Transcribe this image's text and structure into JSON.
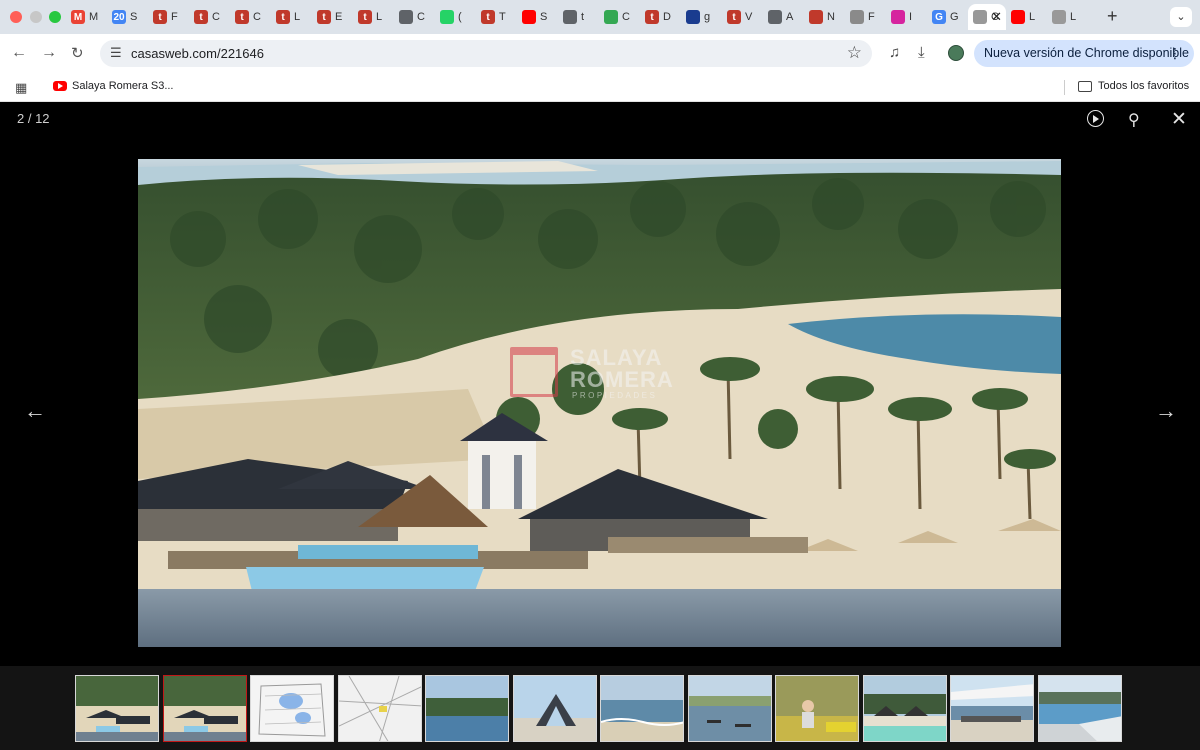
{
  "browser": {
    "tabs": [
      {
        "icon": "gmail-icon",
        "letter": "M",
        "color": "#ea4335",
        "title": "M"
      },
      {
        "icon": "calendar-icon",
        "letter": "20",
        "color": "#4285f4",
        "title": "S"
      },
      {
        "icon": "tokko-icon",
        "letter": "t",
        "color": "#c0392b",
        "title": "F"
      },
      {
        "icon": "tokko-icon",
        "letter": "t",
        "color": "#c0392b",
        "title": "C"
      },
      {
        "icon": "tokko-icon",
        "letter": "t",
        "color": "#c0392b",
        "title": "C"
      },
      {
        "icon": "tokko-icon",
        "letter": "t",
        "color": "#c0392b",
        "title": "L"
      },
      {
        "icon": "tokko-icon",
        "letter": "t",
        "color": "#c0392b",
        "title": "E"
      },
      {
        "icon": "tokko-icon",
        "letter": "t",
        "color": "#c0392b",
        "title": "L"
      },
      {
        "icon": "globe-icon",
        "letter": "",
        "color": "#5f6368",
        "title": "C"
      },
      {
        "icon": "whatsapp-icon",
        "letter": "",
        "color": "#25d366",
        "title": "("
      },
      {
        "icon": "tokko-icon",
        "letter": "t",
        "color": "#c0392b",
        "title": "T"
      },
      {
        "icon": "youtube-icon",
        "letter": "",
        "color": "#ff0000",
        "title": "S"
      },
      {
        "icon": "globe-icon",
        "letter": "",
        "color": "#5f6368",
        "title": "t"
      },
      {
        "icon": "maps-icon",
        "letter": "",
        "color": "#34a853",
        "title": "C"
      },
      {
        "icon": "tokko-icon",
        "letter": "t",
        "color": "#c0392b",
        "title": "D"
      },
      {
        "icon": "monitor-icon",
        "letter": "",
        "color": "#1a3c8f",
        "title": "g"
      },
      {
        "icon": "tokko-icon",
        "letter": "t",
        "color": "#c0392b",
        "title": "V"
      },
      {
        "icon": "globe-icon",
        "letter": "",
        "color": "#5f6368",
        "title": "A"
      },
      {
        "icon": "magnet-icon",
        "letter": "",
        "color": "#c0392b",
        "title": "N"
      },
      {
        "icon": "umbrella-icon",
        "letter": "",
        "color": "#8a8a8a",
        "title": "F"
      },
      {
        "icon": "instagram-icon",
        "letter": "",
        "color": "#d6249f",
        "title": "I"
      },
      {
        "icon": "google-icon",
        "letter": "G",
        "color": "#4285f4",
        "title": "G"
      },
      {
        "icon": "page-icon",
        "letter": "",
        "color": "#999999",
        "title": "C"
      },
      {
        "icon": "youtube-icon",
        "letter": "",
        "color": "#ff0000",
        "title": "L"
      },
      {
        "icon": "page-icon",
        "letter": "",
        "color": "#999999",
        "title": "L"
      }
    ],
    "active_tab_index": 22,
    "url": "casasweb.com/221646",
    "update_label": "Nueva versión de Chrome disponible",
    "bookmark_label": "Salaya Romera S3...",
    "all_bookmarks_label": "Todos los favoritos"
  },
  "gallery": {
    "counter": "2 / 12",
    "current_index": 2,
    "total": 12,
    "watermark": {
      "line1": "SALAYA",
      "line2": "ROMERA",
      "line3": "PROPIEDADES"
    },
    "thumbnails": [
      {
        "scene": "resort-render"
      },
      {
        "scene": "resort-render"
      },
      {
        "scene": "site-map"
      },
      {
        "scene": "street-map"
      },
      {
        "scene": "lake-trees"
      },
      {
        "scene": "beach-hut"
      },
      {
        "scene": "ocean-beach"
      },
      {
        "scene": "lake-boats"
      },
      {
        "scene": "reeds-person"
      },
      {
        "scene": "pool-cabanas"
      },
      {
        "scene": "shade-canopy"
      },
      {
        "scene": "infinity-pool"
      }
    ]
  }
}
